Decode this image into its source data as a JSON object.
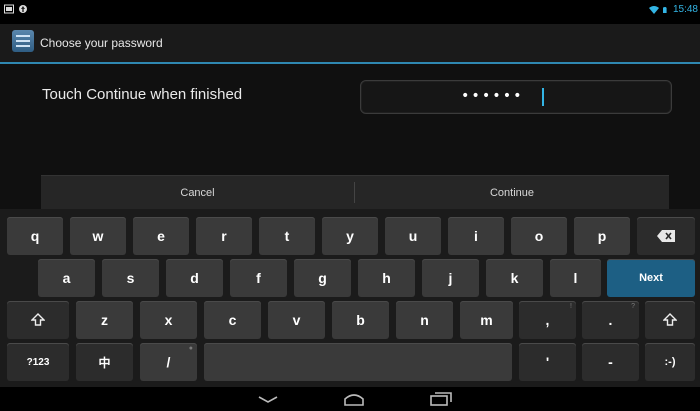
{
  "status_bar": {
    "time": "15:48",
    "left_icons": [
      "screenshot-icon",
      "cloud-upload-icon"
    ],
    "right_icons": [
      "wifi-icon",
      "battery-icon"
    ],
    "accent": "#33b5e5"
  },
  "action_bar": {
    "title": "Choose your password",
    "app_icon": "settings-sliders-icon"
  },
  "content": {
    "instruction": "Touch Continue when finished",
    "password_mask": "••••••"
  },
  "buttons": {
    "cancel": "Cancel",
    "continue": "Continue"
  },
  "keyboard": {
    "row1": [
      "q",
      "w",
      "e",
      "r",
      "t",
      "y",
      "u",
      "i",
      "o",
      "p"
    ],
    "row2": [
      "a",
      "s",
      "d",
      "f",
      "g",
      "h",
      "j",
      "k",
      "l"
    ],
    "row3": [
      "z",
      "x",
      "c",
      "v",
      "b",
      "n",
      "m",
      ",",
      "."
    ],
    "row3_hints": [
      "!",
      "?"
    ],
    "row4": {
      "symbols": "?123",
      "lang": "中",
      "slash": "/",
      "quote": "'",
      "dash": "-",
      "smiley": ":-)"
    },
    "next": "Next",
    "next_color": "#1d5f84"
  },
  "nav_bar": {
    "icons": [
      "back-chevron-icon",
      "home-icon",
      "recent-apps-icon"
    ]
  }
}
